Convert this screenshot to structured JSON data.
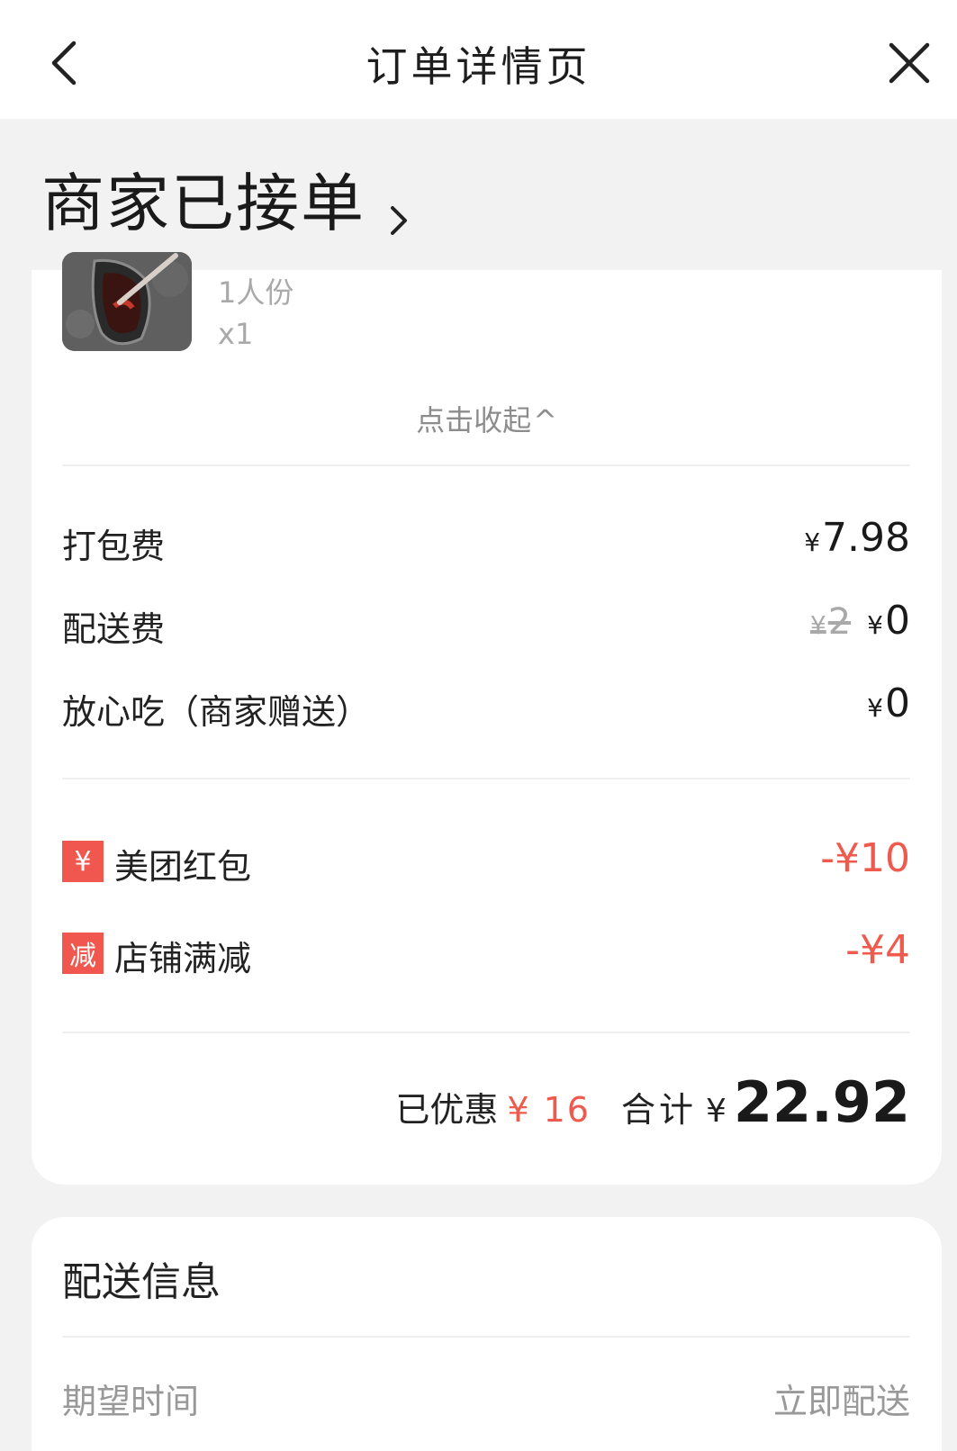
{
  "header": {
    "title": "订单详情页"
  },
  "order_status": {
    "text": "商家已接单"
  },
  "item": {
    "spec": "1人份",
    "quantity": "x1"
  },
  "collapse": {
    "label": "点击收起",
    "caret": "^"
  },
  "fees": [
    {
      "label": "打包费",
      "currency": "¥",
      "amount": "7.98"
    },
    {
      "label": "配送费",
      "original_currency": "¥",
      "original_amount": "2",
      "currency": "¥",
      "amount": "0"
    },
    {
      "label": "放心吃（商家赠送）",
      "currency": "¥",
      "amount": "0"
    }
  ],
  "discounts": [
    {
      "badge": "¥",
      "label": "美团红包",
      "amount": "-¥10"
    },
    {
      "badge": "减",
      "label": "店铺满减",
      "amount": "-¥4"
    }
  ],
  "summary": {
    "saved_label": "已优惠",
    "saved_amount": "¥ 16",
    "total_label": "合计",
    "currency": "¥",
    "total_amount": "22.92"
  },
  "delivery": {
    "heading": "配送信息",
    "row_label": "期望时间",
    "row_value": "立即配送"
  },
  "colors": {
    "accent_red": "#ef5a4e",
    "badge_red": "#f0574f",
    "page_bg": "#f2f2f2"
  }
}
